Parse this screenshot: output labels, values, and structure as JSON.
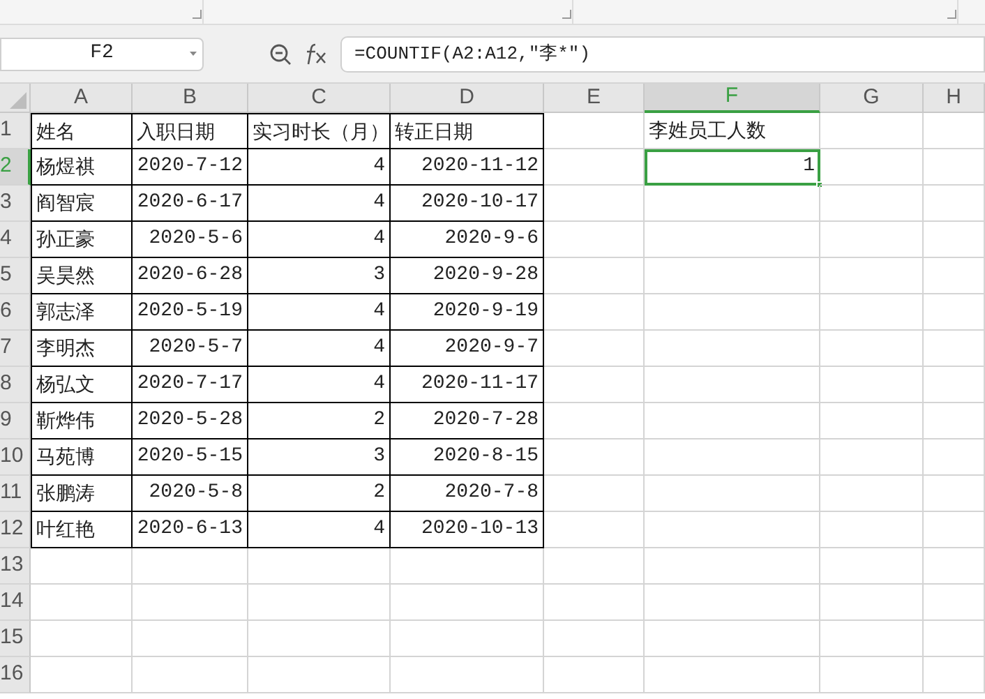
{
  "name_box": {
    "value": "F2"
  },
  "formula_bar": {
    "value": "=COUNTIF(A2:A12,\"李*\")"
  },
  "columns": [
    {
      "label": "A",
      "selected": false
    },
    {
      "label": "B",
      "selected": false
    },
    {
      "label": "C",
      "selected": false
    },
    {
      "label": "D",
      "selected": false
    },
    {
      "label": "E",
      "selected": false
    },
    {
      "label": "F",
      "selected": true
    },
    {
      "label": "G",
      "selected": false
    },
    {
      "label": "H",
      "selected": false
    }
  ],
  "row_headers": [
    {
      "label": "1",
      "selected": false
    },
    {
      "label": "2",
      "selected": true
    },
    {
      "label": "3",
      "selected": false
    },
    {
      "label": "4",
      "selected": false
    },
    {
      "label": "5",
      "selected": false
    },
    {
      "label": "6",
      "selected": false
    },
    {
      "label": "7",
      "selected": false
    },
    {
      "label": "8",
      "selected": false
    },
    {
      "label": "9",
      "selected": false
    },
    {
      "label": "10",
      "selected": false
    },
    {
      "label": "11",
      "selected": false
    },
    {
      "label": "12",
      "selected": false
    },
    {
      "label": "13",
      "selected": false
    },
    {
      "label": "14",
      "selected": false
    },
    {
      "label": "15",
      "selected": false
    },
    {
      "label": "16",
      "selected": false
    }
  ],
  "table": {
    "headers": [
      "姓名",
      "入职日期",
      "实习时长（月）",
      "转正日期"
    ],
    "rows": [
      {
        "name": "杨煜祺",
        "hire_date": "2020-7-12",
        "months": "4",
        "confirm_date": "2020-11-12"
      },
      {
        "name": "阎智宸",
        "hire_date": "2020-6-17",
        "months": "4",
        "confirm_date": "2020-10-17"
      },
      {
        "name": "孙正豪",
        "hire_date": "2020-5-6",
        "months": "4",
        "confirm_date": "2020-9-6"
      },
      {
        "name": "吴昊然",
        "hire_date": "2020-6-28",
        "months": "3",
        "confirm_date": "2020-9-28"
      },
      {
        "name": "郭志泽",
        "hire_date": "2020-5-19",
        "months": "4",
        "confirm_date": "2020-9-19"
      },
      {
        "name": "李明杰",
        "hire_date": "2020-5-7",
        "months": "4",
        "confirm_date": "2020-9-7"
      },
      {
        "name": "杨弘文",
        "hire_date": "2020-7-17",
        "months": "4",
        "confirm_date": "2020-11-17"
      },
      {
        "name": "靳烨伟",
        "hire_date": "2020-5-28",
        "months": "2",
        "confirm_date": "2020-7-28"
      },
      {
        "name": "马苑博",
        "hire_date": "2020-5-15",
        "months": "3",
        "confirm_date": "2020-8-15"
      },
      {
        "name": "张鹏涛",
        "hire_date": "2020-5-8",
        "months": "2",
        "confirm_date": "2020-7-8"
      },
      {
        "name": "叶红艳",
        "hire_date": "2020-6-13",
        "months": "4",
        "confirm_date": "2020-10-13"
      }
    ]
  },
  "summary": {
    "label": "李姓员工人数",
    "value": "1",
    "selected": true
  }
}
